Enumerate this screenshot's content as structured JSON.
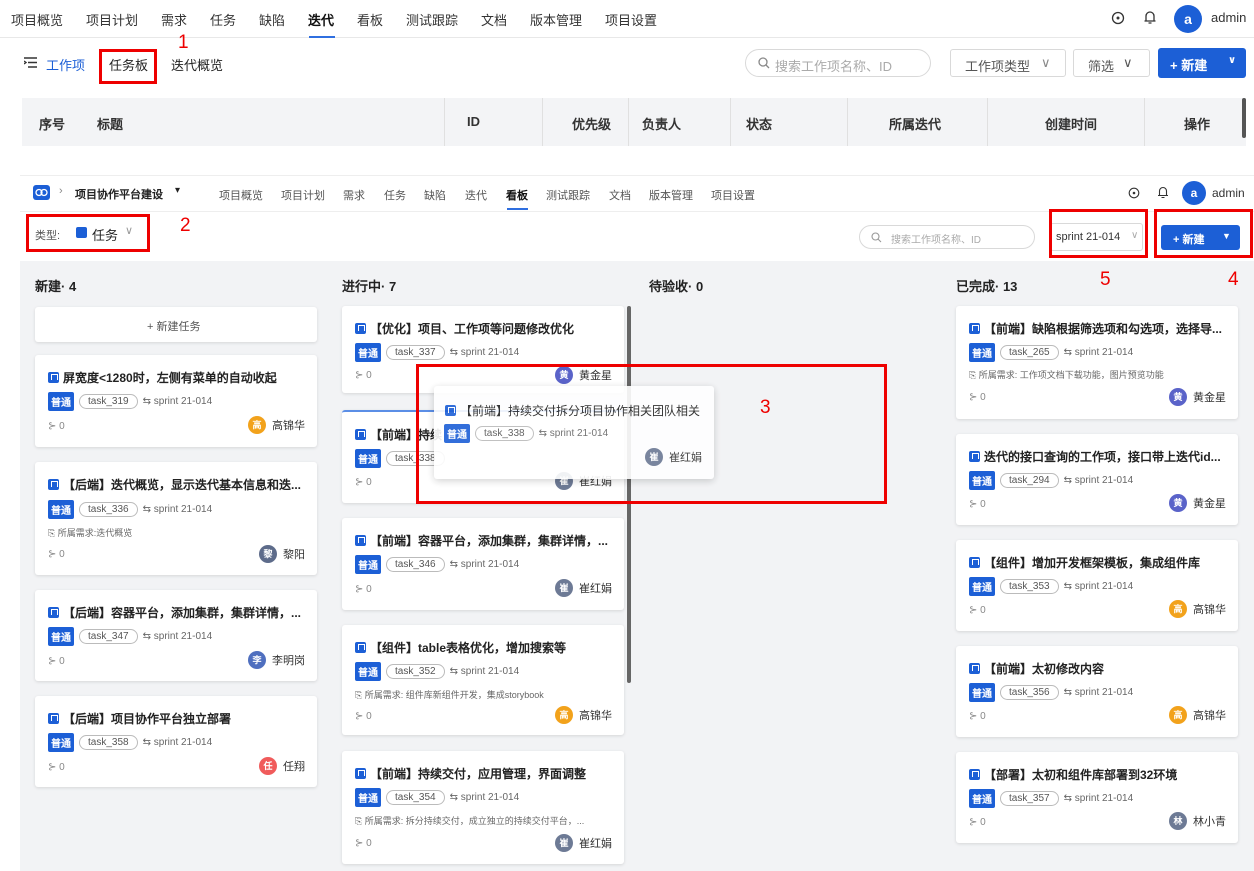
{
  "top": {
    "nav": [
      "项目概览",
      "项目计划",
      "需求",
      "任务",
      "缺陷",
      "迭代",
      "看板",
      "测试跟踪",
      "文档",
      "版本管理",
      "项目设置"
    ],
    "user": {
      "initial": "a",
      "name": "admin"
    },
    "subtabs": [
      "工作项",
      "任务板",
      "迭代概览"
    ],
    "search_placeholder": "搜索工作项名称、ID",
    "type_btn": "工作项类型",
    "filter_btn": "筛选",
    "new_btn": "+ 新建",
    "table_headers": [
      "序号",
      "标题",
      "ID",
      "优先级",
      "负责人",
      "状态",
      "所属迭代",
      "创建时间",
      "操作"
    ]
  },
  "bottom": {
    "project": "项目协作平台建设",
    "nav": [
      "项目概览",
      "项目计划",
      "需求",
      "任务",
      "缺陷",
      "迭代",
      "看板",
      "测试跟踪",
      "文档",
      "版本管理",
      "项目设置"
    ],
    "user": {
      "initial": "a",
      "name": "admin"
    },
    "type_label": "类型:",
    "type_value": "任务",
    "search_placeholder": "搜索工作项名称、ID",
    "sprint": "sprint 21-014",
    "new_btn": "+ 新建",
    "columns": [
      "新建· 4",
      "进行中· 7",
      "待验收· 0",
      "已完成· 13"
    ],
    "new_task_btn": "+ 新建任务",
    "priority": "普通",
    "req_prefix": "所属需求:",
    "sub_count": "0",
    "cards_new": [
      {
        "title": "屏宽度<1280时，左侧有菜单的自动收起",
        "id": "task_319",
        "assignee": "高锦华",
        "initial": "高",
        "color": "#f2a21b"
      },
      {
        "title": "【后端】迭代概览，显示迭代基本信息和迭...",
        "id": "task_336",
        "req": "迭代概览",
        "assignee": "黎阳",
        "initial": "黎",
        "color": "#5d6b8a"
      },
      {
        "title": "【后端】容器平台，添加集群，集群详情，...",
        "id": "task_347",
        "assignee": "李明岗",
        "initial": "李",
        "color": "#4f6fbf"
      },
      {
        "title": "【后端】项目协作平台独立部署",
        "id": "task_358",
        "assignee": "任翔",
        "initial": "任",
        "color": "#f05b5b"
      }
    ],
    "cards_prog": [
      {
        "title": "【优化】项目、工作项等问题修改优化",
        "id": "task_337",
        "assignee": "黄金星",
        "initial": "黄",
        "color": "#5a63c9"
      },
      {
        "title": "【前端】持续",
        "id": "task_338",
        "assignee": "崔红娟",
        "initial": "崔",
        "color": "#6d7a95"
      },
      {
        "title": "【前端】容器平台，添加集群，集群详情，...",
        "id": "task_346",
        "assignee": "崔红娟",
        "initial": "崔",
        "color": "#6d7a95"
      },
      {
        "title": "【组件】table表格优化，增加搜索等",
        "id": "task_352",
        "req": "组件库新组件开发，集成storybook",
        "assignee": "高锦华",
        "initial": "高",
        "color": "#f2a21b"
      },
      {
        "title": "【前端】持续交付，应用管理，界面调整",
        "id": "task_354",
        "req": "拆分持续交付，成立独立的持续交付平台，...",
        "assignee": "崔红娟",
        "initial": "崔",
        "color": "#6d7a95"
      }
    ],
    "drag_card": {
      "title": "【前端】持续交付拆分项目协作相关团队相关",
      "id": "task_338",
      "assignee": "崔红娟",
      "initial": "崔",
      "color": "#6d7a95"
    },
    "cards_done": [
      {
        "title": "【前端】缺陷根据筛选项和勾选项，选择导...",
        "id": "task_265",
        "req": "工作项文档下载功能，图片预览功能",
        "assignee": "黄金星",
        "initial": "黄",
        "color": "#5a63c9"
      },
      {
        "title": "迭代的接口查询的工作项，接口带上迭代id...",
        "id": "task_294",
        "assignee": "黄金星",
        "initial": "黄",
        "color": "#5a63c9"
      },
      {
        "title": "【组件】增加开发框架模板，集成组件库",
        "id": "task_353",
        "assignee": "高锦华",
        "initial": "高",
        "color": "#f2a21b"
      },
      {
        "title": "【前端】太初修改内容",
        "id": "task_356",
        "assignee": "高锦华",
        "initial": "高",
        "color": "#f2a21b"
      },
      {
        "title": "【部署】太初和组件库部署到32环境",
        "id": "task_357",
        "assignee": "林小青",
        "initial": "林",
        "color": "#6d7a95"
      }
    ]
  },
  "annotations": [
    "1",
    "2",
    "3",
    "4",
    "5"
  ]
}
